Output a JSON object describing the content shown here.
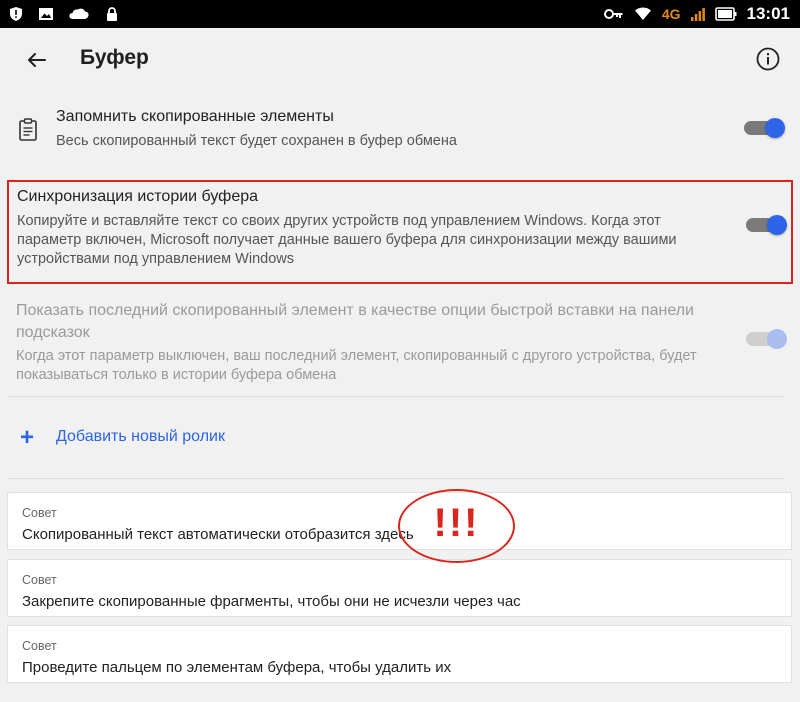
{
  "status_bar": {
    "time": "13:01",
    "network": "4G",
    "left_icons": [
      "shield-icon",
      "image-icon",
      "cloud-icon",
      "lock-icon"
    ],
    "right_icons": [
      "key-icon",
      "wifi-icon",
      "signal-icon",
      "battery-icon"
    ]
  },
  "appbar": {
    "title": "Буфер",
    "back_icon": "arrow-left-icon",
    "info_icon": "info-icon"
  },
  "settings": {
    "remember": {
      "title": "Запомнить скопированные элементы",
      "description": "Весь скопированный текст будет сохранен в буфер обмена",
      "enabled": true,
      "icon": "clipboard-icon"
    },
    "sync": {
      "title": "Синхронизация истории буфера",
      "description": "Копируйте и вставляйте текст со своих других устройств под управлением Windows. Когда этот параметр включен, Microsoft получает данные вашего буфера для синхронизации между вашими устройствами под управлением Windows",
      "enabled": true
    },
    "show_last": {
      "title": "Показать последний скопированный элемент в качестве опции быстрой вставки на панели подсказок",
      "description": "Когда этот параметр выключен, ваш последний элемент, скопированный с другого устройства, будет показываться только в истории буфера обмена",
      "enabled": true,
      "disabled": true
    }
  },
  "add_clip": {
    "icon": "plus-icon",
    "label": "Добавить новый ролик"
  },
  "tips": [
    {
      "heading": "Совет",
      "text": "Скопированный текст автоматически отобразится здесь"
    },
    {
      "heading": "Совет",
      "text": "Закрепите скопированные фрагменты, чтобы они не исчезли через час"
    },
    {
      "heading": "Совет",
      "text": "Проведите пальцем по элементам буфера, чтобы удалить их"
    }
  ],
  "annotation": {
    "text": "!!!"
  },
  "colors": {
    "accent": "#2d64e8",
    "highlight": "#d9261c",
    "network_4g": "#e08a1e"
  }
}
